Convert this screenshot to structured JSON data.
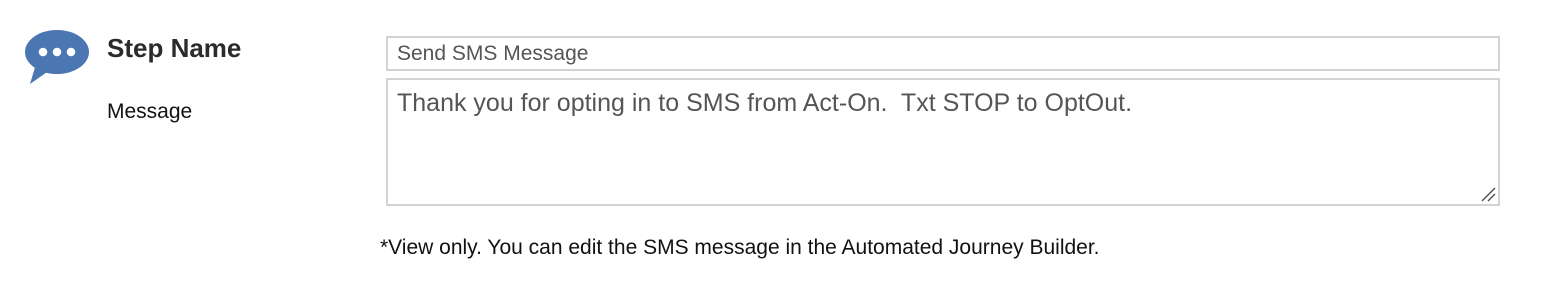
{
  "icon": {
    "name": "chat-bubble-icon",
    "color": "#4a76b1"
  },
  "step_name": {
    "label": "Step Name",
    "value": "Send SMS Message"
  },
  "message": {
    "label": "Message",
    "value": "Thank you for opting in to SMS from Act-On.  Txt STOP to OptOut."
  },
  "footnote": "*View only. You can edit the SMS message in the Automated Journey Builder."
}
